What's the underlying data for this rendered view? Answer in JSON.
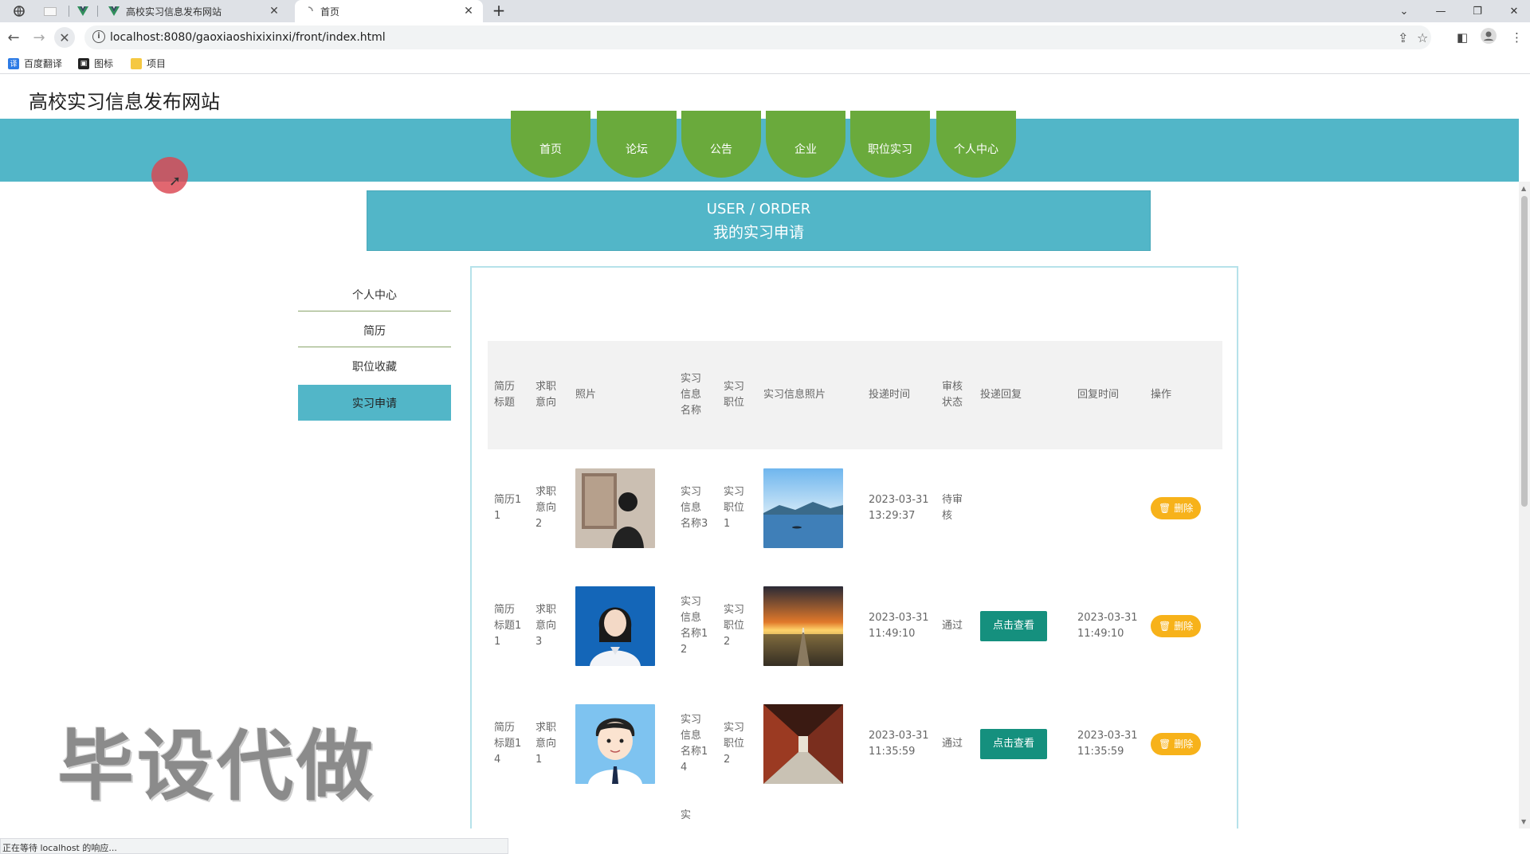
{
  "browser": {
    "tabs": [
      {
        "title": "高校实习信息发布网站",
        "active": false
      },
      {
        "title": "首页",
        "active": true
      }
    ],
    "url": "localhost:8080/gaoxiaoshixixinxi/front/index.html",
    "bookmarks": [
      "百度翻译",
      "图标",
      "项目"
    ],
    "status_text": "正在等待 localhost 的响应..."
  },
  "site": {
    "title": "高校实习信息发布网站",
    "nav": [
      "首页",
      "论坛",
      "公告",
      "企业",
      "职位实习",
      "个人中心"
    ]
  },
  "banner": {
    "en": "USER / ORDER",
    "zh": "我的实习申请"
  },
  "sidebar": {
    "items": [
      "个人中心",
      "简历",
      "职位收藏",
      "实习申请"
    ],
    "active": "实习申请"
  },
  "table": {
    "headers": [
      "简历标题",
      "求职意向",
      "照片",
      "实习信息名称",
      "实习职位",
      "实习信息照片",
      "投递时间",
      "审核状态",
      "投递回复",
      "回复时间",
      "操作"
    ],
    "rows": [
      {
        "resume": "简历11",
        "intent": "求职意向2",
        "photo": "person-gallery",
        "info_name": "实习信息名称3",
        "position": "实习职位1",
        "info_photo": "lake-landscape",
        "submit_time": "2023-03-31 13:29:37",
        "status": "待审核",
        "reply_btn": "",
        "reply_time": "",
        "delete_label": "删除"
      },
      {
        "resume": "简历标题11",
        "intent": "求职意向3",
        "photo": "portrait-woman",
        "info_name": "实习信息名称12",
        "position": "实习职位2",
        "info_photo": "sunset-road",
        "submit_time": "2023-03-31 11:49:10",
        "status": "通过",
        "reply_btn": "点击查看",
        "reply_time": "2023-03-31 11:49:10",
        "delete_label": "删除"
      },
      {
        "resume": "简历标题14",
        "intent": "求职意向1",
        "photo": "cartoon-man",
        "info_name": "实习信息名称14",
        "position": "实习职位2",
        "info_photo": "corridor",
        "submit_time": "2023-03-31 11:35:59",
        "status": "通过",
        "reply_btn": "点击查看",
        "reply_time": "2023-03-31 11:35:59",
        "delete_label": "删除"
      }
    ],
    "partial_next_row_text": "实"
  },
  "watermark": "毕设代做",
  "colors": {
    "nav_band": "#52b6c8",
    "nav_item": "#6aaa3c",
    "view_button": "#15907e",
    "delete_button": "#f7b21a"
  }
}
